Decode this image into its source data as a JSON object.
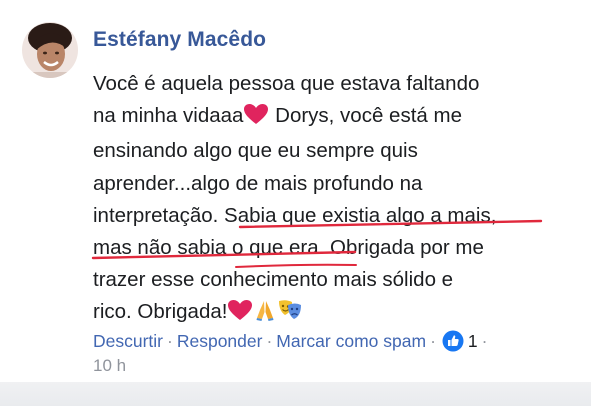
{
  "comment": {
    "author": "Estéfany Macêdo",
    "lines": [
      "Você é aquela pessoa que estava faltando",
      "na minha vidaaa",
      " Dorys, você está me",
      "ensinando algo que eu sempre quis",
      "aprender...algo de mais profundo na",
      "interpretação. Sabia que existia algo a mais,",
      "mas não sabia o que era. Obrigada por me",
      "trazer esse conhecimento mais sólido e",
      "rico. Obrigada!"
    ],
    "emojis": [
      "heart-emoji",
      "heart-emoji",
      "praying-hands-emoji",
      "theater-masks-emoji"
    ],
    "underline_color": "#e0283c"
  },
  "actions": {
    "uncurtir": "Descurtir",
    "responder": "Responder",
    "spam": "Marcar como spam",
    "separator": "·",
    "like_count": "1",
    "trailing_dot": "·",
    "timestamp": "10 h"
  },
  "colors": {
    "author": "#385898",
    "link": "#4267b2",
    "text": "#1c1e21",
    "meta": "#90949c",
    "heart": "#e0245e",
    "like_badge": "#1877f2"
  }
}
